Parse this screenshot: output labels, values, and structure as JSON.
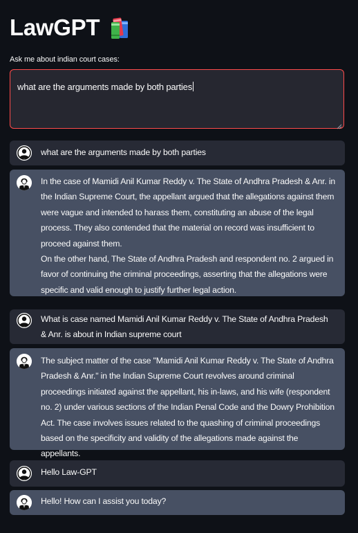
{
  "app": {
    "title": "LawGPT",
    "title_icon": "books-icon"
  },
  "query": {
    "label": "Ask me about indian court cases:",
    "value": "what are the arguments made by both parties"
  },
  "messages": [
    {
      "role": "user",
      "avatar": "user-avatar-icon",
      "paragraphs": [
        "what are the arguments made by both parties"
      ]
    },
    {
      "role": "bot",
      "avatar": "lawyer-avatar-icon",
      "paragraphs": [
        "In the case of Mamidi Anil Kumar Reddy v. The State of Andhra Pradesh & Anr. in the Indian Supreme Court, the appellant argued that the allegations against them were vague and intended to harass them, constituting an abuse of the legal process. They also contended that the material on record was insufficient to proceed against them.",
        "On the other hand, The State of Andhra Pradesh and respondent no. 2 argued in favor of continuing the criminal proceedings, asserting that the allegations were specific and valid enough to justify further legal action."
      ]
    },
    {
      "role": "user",
      "avatar": "user-avatar-icon",
      "paragraphs": [
        "What is case named Mamidi Anil Kumar Reddy v. The State of Andhra Pradesh & Anr. is about in Indian supreme court"
      ]
    },
    {
      "role": "bot",
      "avatar": "lawyer-avatar-icon",
      "paragraphs": [
        "The subject matter of the case \"Mamidi Anil Kumar Reddy v. The State of Andhra Pradesh & Anr.\" in the Indian Supreme Court revolves around criminal proceedings initiated against the appellant, his in-laws, and his wife (respondent no. 2) under various sections of the Indian Penal Code and the Dowry Prohibition Act. The case involves issues related to the quashing of criminal proceedings based on the specificity and validity of the allegations made against the appellants."
      ]
    },
    {
      "role": "user",
      "avatar": "user-avatar-icon",
      "paragraphs": [
        "Hello Law-GPT"
      ]
    },
    {
      "role": "bot",
      "avatar": "lawyer-avatar-icon",
      "paragraphs": [
        "Hello! How can I assist you today?"
      ]
    }
  ],
  "colors": {
    "background": "#0e1117",
    "input_background": "#262730",
    "input_border_focus": "#ff4b4b",
    "user_message_background": "#272a35",
    "bot_message_background": "#475063",
    "text": "#fafafa"
  }
}
